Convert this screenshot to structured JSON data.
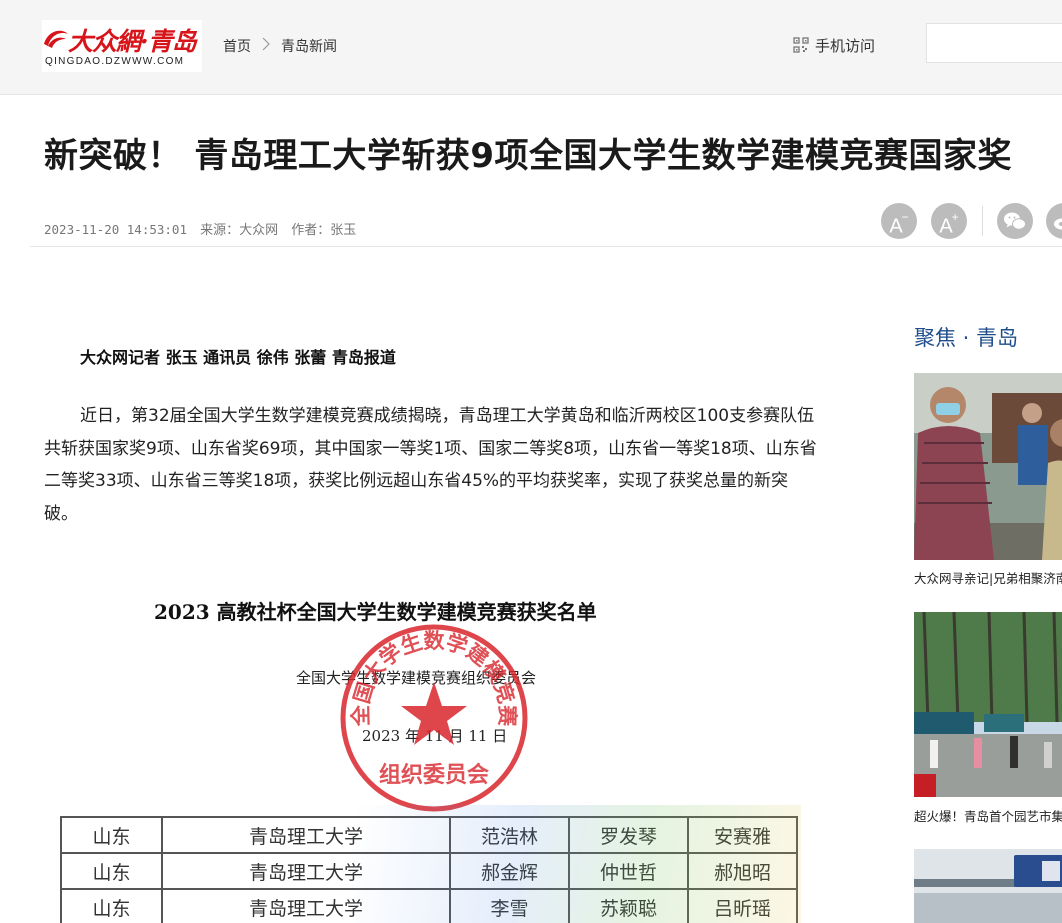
{
  "header": {
    "logo_text": "大众網·青岛",
    "logo_domain": "QINGDAO.DZWWW.COM",
    "breadcrumb": [
      "首页",
      "青岛新闻"
    ],
    "mobile_label": "手机访问",
    "search_placeholder": ""
  },
  "article": {
    "title": "新突破！ 青岛理工大学斩获9项全国大学生数学建模竞赛国家奖",
    "date": "2023-11-20 14:53:01",
    "source": "来源：大众网",
    "author": "作者：张玉",
    "lead": "大众网记者 张玉 通讯员 徐伟 张蕾 青岛报道",
    "paragraph": "近日，第32届全国大学生数学建模竞赛成绩揭晓，青岛理工大学黄岛和临沂两校区100支参赛队伍共斩获国家奖9项、山东省奖69项，其中国家一等奖1项、国家二等奖8项，山东省一等奖18项、山东省二等奖33项、山东省三等奖18项，获奖比例远超山东省45%的平均获奖率，实现了获奖总量的新突破。"
  },
  "tools": {
    "font_smaller": "A",
    "font_larger": "A",
    "font_smaller_sign": "−",
    "font_larger_sign": "+"
  },
  "document_image": {
    "title": "2023 高教社杯全国大学生数学建模竞赛获奖名单",
    "organizer": "全国大学生数学建模竞赛组织委员会",
    "date": "2023 年 11 月 11 日",
    "seal_top_text": "全国大学生数学建模竞赛",
    "seal_bottom_text": "组织委员会",
    "rows": [
      [
        "山东",
        "青岛理工大学",
        "范浩林",
        "罗发琴",
        "安赛雅"
      ],
      [
        "山东",
        "青岛理工大学",
        "郝金辉",
        "仲世哲",
        "郝旭昭"
      ],
      [
        "山东",
        "青岛理工大学",
        "李雪",
        "苏颖聪",
        "吕昕瑶"
      ]
    ]
  },
  "sidebar": {
    "title": "聚焦 · 青岛",
    "items": [
      {
        "caption": "大众网寻亲记|兄弟相聚济南"
      },
      {
        "caption": "超火爆！青岛首个园艺市集"
      }
    ]
  },
  "colors": {
    "brand_red": "#d7141a",
    "sidebar_blue": "#1f4e8c",
    "tool_gray": "#bcbcbc"
  }
}
